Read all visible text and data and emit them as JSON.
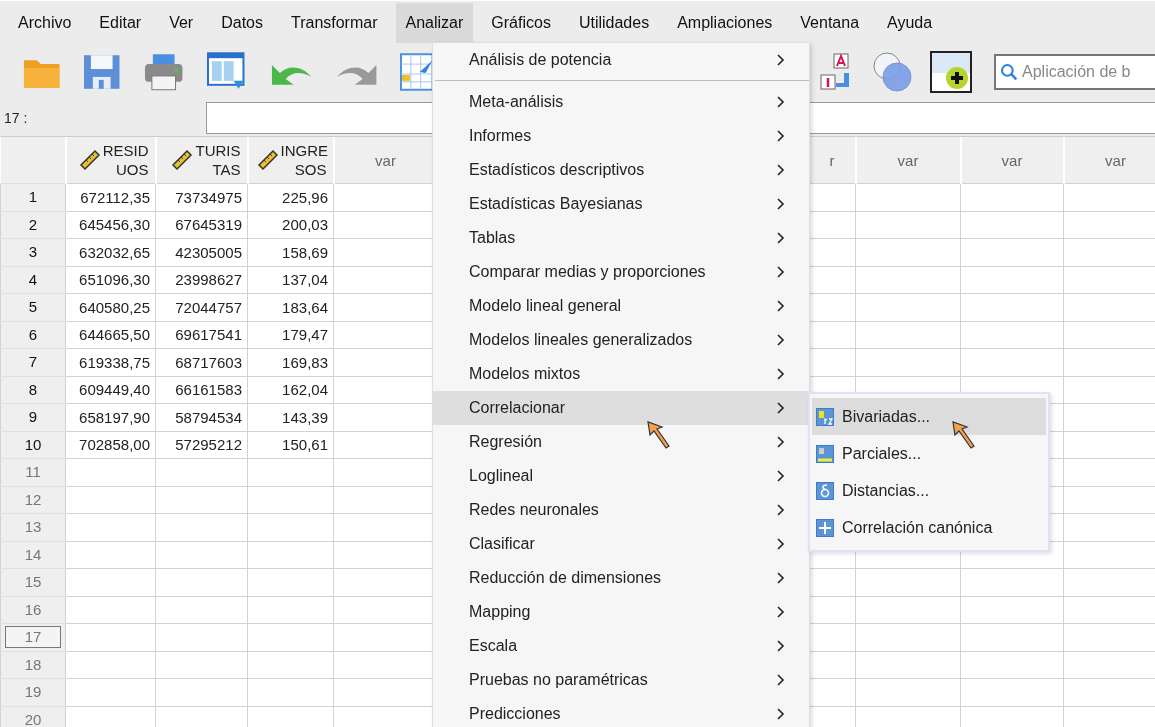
{
  "menubar": [
    {
      "label": "Archivo",
      "selected": false
    },
    {
      "label": "Editar",
      "selected": false
    },
    {
      "label": "Ver",
      "selected": false
    },
    {
      "label": "Datos",
      "selected": false
    },
    {
      "label": "Transformar",
      "selected": false
    },
    {
      "label": "Analizar",
      "selected": true
    },
    {
      "label": "Gráficos",
      "selected": false
    },
    {
      "label": "Utilidades",
      "selected": false
    },
    {
      "label": "Ampliaciones",
      "selected": false
    },
    {
      "label": "Ventana",
      "selected": false
    },
    {
      "label": "Ayuda",
      "selected": false
    }
  ],
  "toolbar": {
    "search": {
      "placeholder": "Aplicación de b"
    }
  },
  "cell_editor": {
    "case_label": "17 :"
  },
  "grid": {
    "columns": [
      {
        "label": "RESID UOS",
        "kind": "scale"
      },
      {
        "label": "TURIS TAS",
        "kind": "scale"
      },
      {
        "label": "INGRE SOS",
        "kind": "scale"
      },
      {
        "label": "var",
        "kind": "empty"
      },
      {
        "kind": "empty"
      },
      {
        "kind": "empty"
      },
      {
        "kind": "empty"
      },
      {
        "label": "r",
        "kind": "cut"
      },
      {
        "label": "var",
        "kind": "empty"
      },
      {
        "label": "var",
        "kind": "empty"
      },
      {
        "label": "var",
        "kind": "empty"
      }
    ],
    "rows": [
      {
        "number": "1",
        "selected": false,
        "cells": [
          "672112,35",
          "73734975",
          "225,96"
        ]
      },
      {
        "number": "2",
        "selected": false,
        "cells": [
          "645456,30",
          "67645319",
          "200,03"
        ]
      },
      {
        "number": "3",
        "selected": false,
        "cells": [
          "632032,65",
          "42305005",
          "158,69"
        ]
      },
      {
        "number": "4",
        "selected": false,
        "cells": [
          "651096,30",
          "23998627",
          "137,04"
        ]
      },
      {
        "number": "5",
        "selected": false,
        "cells": [
          "640580,25",
          "72044757",
          "183,64"
        ]
      },
      {
        "number": "6",
        "selected": false,
        "cells": [
          "644665,50",
          "69617541",
          "179,47"
        ]
      },
      {
        "number": "7",
        "selected": false,
        "cells": [
          "619338,75",
          "68717603",
          "169,83"
        ]
      },
      {
        "number": "8",
        "selected": false,
        "cells": [
          "609449,40",
          "66161583",
          "162,04"
        ]
      },
      {
        "number": "9",
        "selected": false,
        "cells": [
          "658197,90",
          "58794534",
          "143,39"
        ]
      },
      {
        "number": "10",
        "selected": false,
        "cells": [
          "702858,00",
          "57295212",
          "150,61"
        ]
      },
      {
        "number": "11",
        "selected": false
      },
      {
        "number": "12",
        "selected": false
      },
      {
        "number": "13",
        "selected": false
      },
      {
        "number": "14",
        "selected": false
      },
      {
        "number": "15",
        "selected": false
      },
      {
        "number": "16",
        "selected": false
      },
      {
        "number": "17",
        "selected": true
      },
      {
        "number": "18",
        "selected": false
      },
      {
        "number": "19",
        "selected": false
      },
      {
        "number": "20",
        "selected": false
      }
    ]
  },
  "menu": {
    "sections": [
      {
        "items": [
          {
            "label": "Análisis de potencia",
            "selected": false
          }
        ]
      },
      {
        "items": [
          {
            "label": "Meta-análisis",
            "selected": false
          },
          {
            "label": "Informes",
            "selected": false
          },
          {
            "label": "Estadísticos descriptivos",
            "selected": false
          },
          {
            "label": "Estadísticas Bayesianas",
            "selected": false
          },
          {
            "label": "Tablas",
            "selected": false
          },
          {
            "label": "Comparar medias y proporciones",
            "selected": false
          },
          {
            "label": "Modelo lineal general",
            "selected": false
          },
          {
            "label": "Modelos lineales generalizados",
            "selected": false
          },
          {
            "label": "Modelos mixtos",
            "selected": false
          },
          {
            "label": "Correlacionar",
            "selected": true
          },
          {
            "label": "Regresión",
            "selected": false
          },
          {
            "label": "Loglineal",
            "selected": false
          },
          {
            "label": "Redes neuronales",
            "selected": false
          },
          {
            "label": "Clasificar",
            "selected": false
          },
          {
            "label": "Reducción de dimensiones",
            "selected": false
          },
          {
            "label": "Mapping",
            "selected": false
          },
          {
            "label": "Escala",
            "selected": false
          },
          {
            "label": "Pruebas no paramétricas",
            "selected": false
          },
          {
            "label": "Predicciones",
            "selected": false
          }
        ]
      }
    ]
  },
  "submenu": {
    "items": [
      {
        "label": "Bivariadas...",
        "selected": true
      },
      {
        "label": "Parciales...",
        "selected": false
      },
      {
        "label": "Distancias...",
        "selected": false
      },
      {
        "label": "Correlación canónica",
        "selected": false
      }
    ]
  }
}
